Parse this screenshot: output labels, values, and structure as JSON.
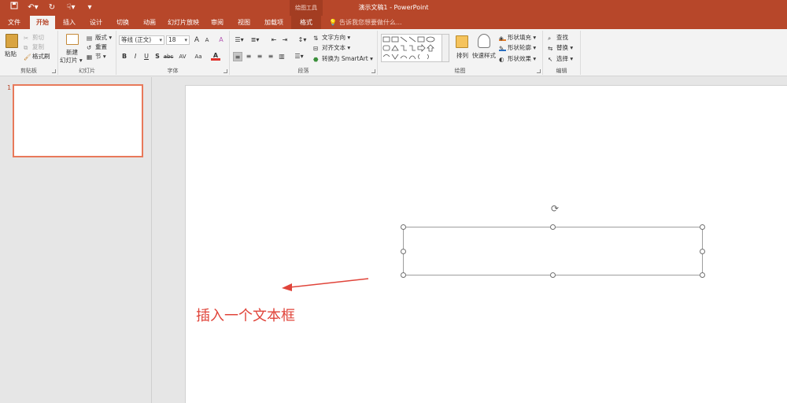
{
  "window": {
    "title": "演示文稿1 - PowerPoint",
    "context_group": "绘图工具"
  },
  "quick_access": [
    "save-icon",
    "undo-icon",
    "redo-icon",
    "touch-mode-icon",
    "customize-qat-icon"
  ],
  "tabs": [
    {
      "label": "文件"
    },
    {
      "label": "开始"
    },
    {
      "label": "插入"
    },
    {
      "label": "设计"
    },
    {
      "label": "切换"
    },
    {
      "label": "动画"
    },
    {
      "label": "幻灯片放映"
    },
    {
      "label": "审阅"
    },
    {
      "label": "视图"
    },
    {
      "label": "加载项"
    },
    {
      "label": "格式"
    }
  ],
  "active_tab": "开始",
  "tell_me": {
    "placeholder": "告诉我您想要做什么..."
  },
  "ribbon": {
    "clipboard": {
      "label": "剪贴板",
      "paste": "粘贴",
      "cut": "剪切",
      "copy": "复制",
      "format_painter": "格式刷"
    },
    "slides": {
      "label": "幻灯片",
      "new_slide_line1": "新建",
      "new_slide_line2": "幻灯片 ▾",
      "layout": "版式 ▾",
      "reset": "重置",
      "section": "节 ▾"
    },
    "font": {
      "label": "字体",
      "font_name": "等线 (正文)",
      "font_size": "18",
      "grow": "A",
      "shrink": "A",
      "clear": "A",
      "bold": "B",
      "italic": "I",
      "underline": "U",
      "shadow": "S",
      "strike": "abc",
      "spacing": "AV",
      "case": "Aa",
      "color": "A"
    },
    "paragraph": {
      "label": "段落",
      "text_direction": "文字方向 ▾",
      "align_text": "对齐文本 ▾",
      "convert_smartart": "转换为 SmartArt ▾"
    },
    "drawing": {
      "label": "绘图",
      "arrange": "排列",
      "quick_styles": "快速样式",
      "shape_fill": "形状填充 ▾",
      "shape_outline": "形状轮廓 ▾",
      "shape_effects": "形状效果 ▾"
    },
    "editing": {
      "label": "编辑",
      "find": "查找",
      "replace": "替换 ▾",
      "select": "选择 ▾"
    }
  },
  "thumbnails": [
    {
      "number": "1"
    }
  ],
  "annotation": {
    "text": "插入一个文本框"
  },
  "colors": {
    "accent": "#b7472a",
    "annotation": "#e0443a"
  }
}
